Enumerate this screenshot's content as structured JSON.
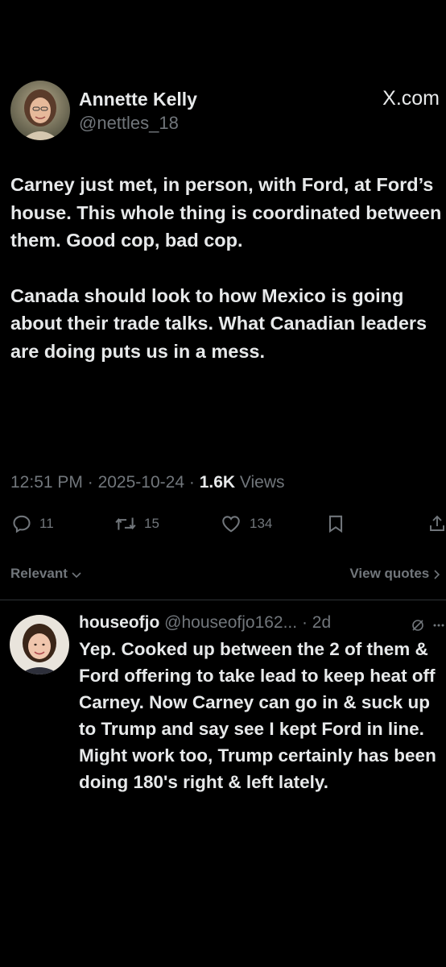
{
  "tweet": {
    "author": {
      "display_name": "Annette Kelly",
      "handle": "@nettles_18",
      "avatar_icon": "profile-photo"
    },
    "brand": "X.com",
    "paragraphs": [
      "Carney just met, in person, with Ford, at Ford’s house.  This whole thing is coordinated between them.  Good cop, bad cop.",
      "Canada should look to how Mexico is going about their trade talks.  What Canadian leaders are doing puts us in a mess."
    ],
    "time": "12:51 PM",
    "date": "2025-10-24",
    "separator": "·",
    "views_count": "1.6K",
    "views_label": "Views",
    "actions": {
      "replies": "11",
      "reposts": "15",
      "likes": "134"
    }
  },
  "sort": {
    "relevant_label": "Relevant",
    "view_quotes_label": "View quotes"
  },
  "reply": {
    "display_name": "houseofjo",
    "handle": "@houseofjo162...",
    "time": "· 2d",
    "text": "Yep.  Cooked up between the 2 of them & Ford offering to take lead to keep heat off Carney.  Now Carney can go in & suck up to Trump and say see I kept Ford in line.  Might work too, Trump certainly has been doing 180's right & left lately."
  },
  "colors": {
    "background": "#000000",
    "text_primary": "#e7e9ea",
    "text_secondary": "#71767b",
    "divider": "#2f3336"
  }
}
